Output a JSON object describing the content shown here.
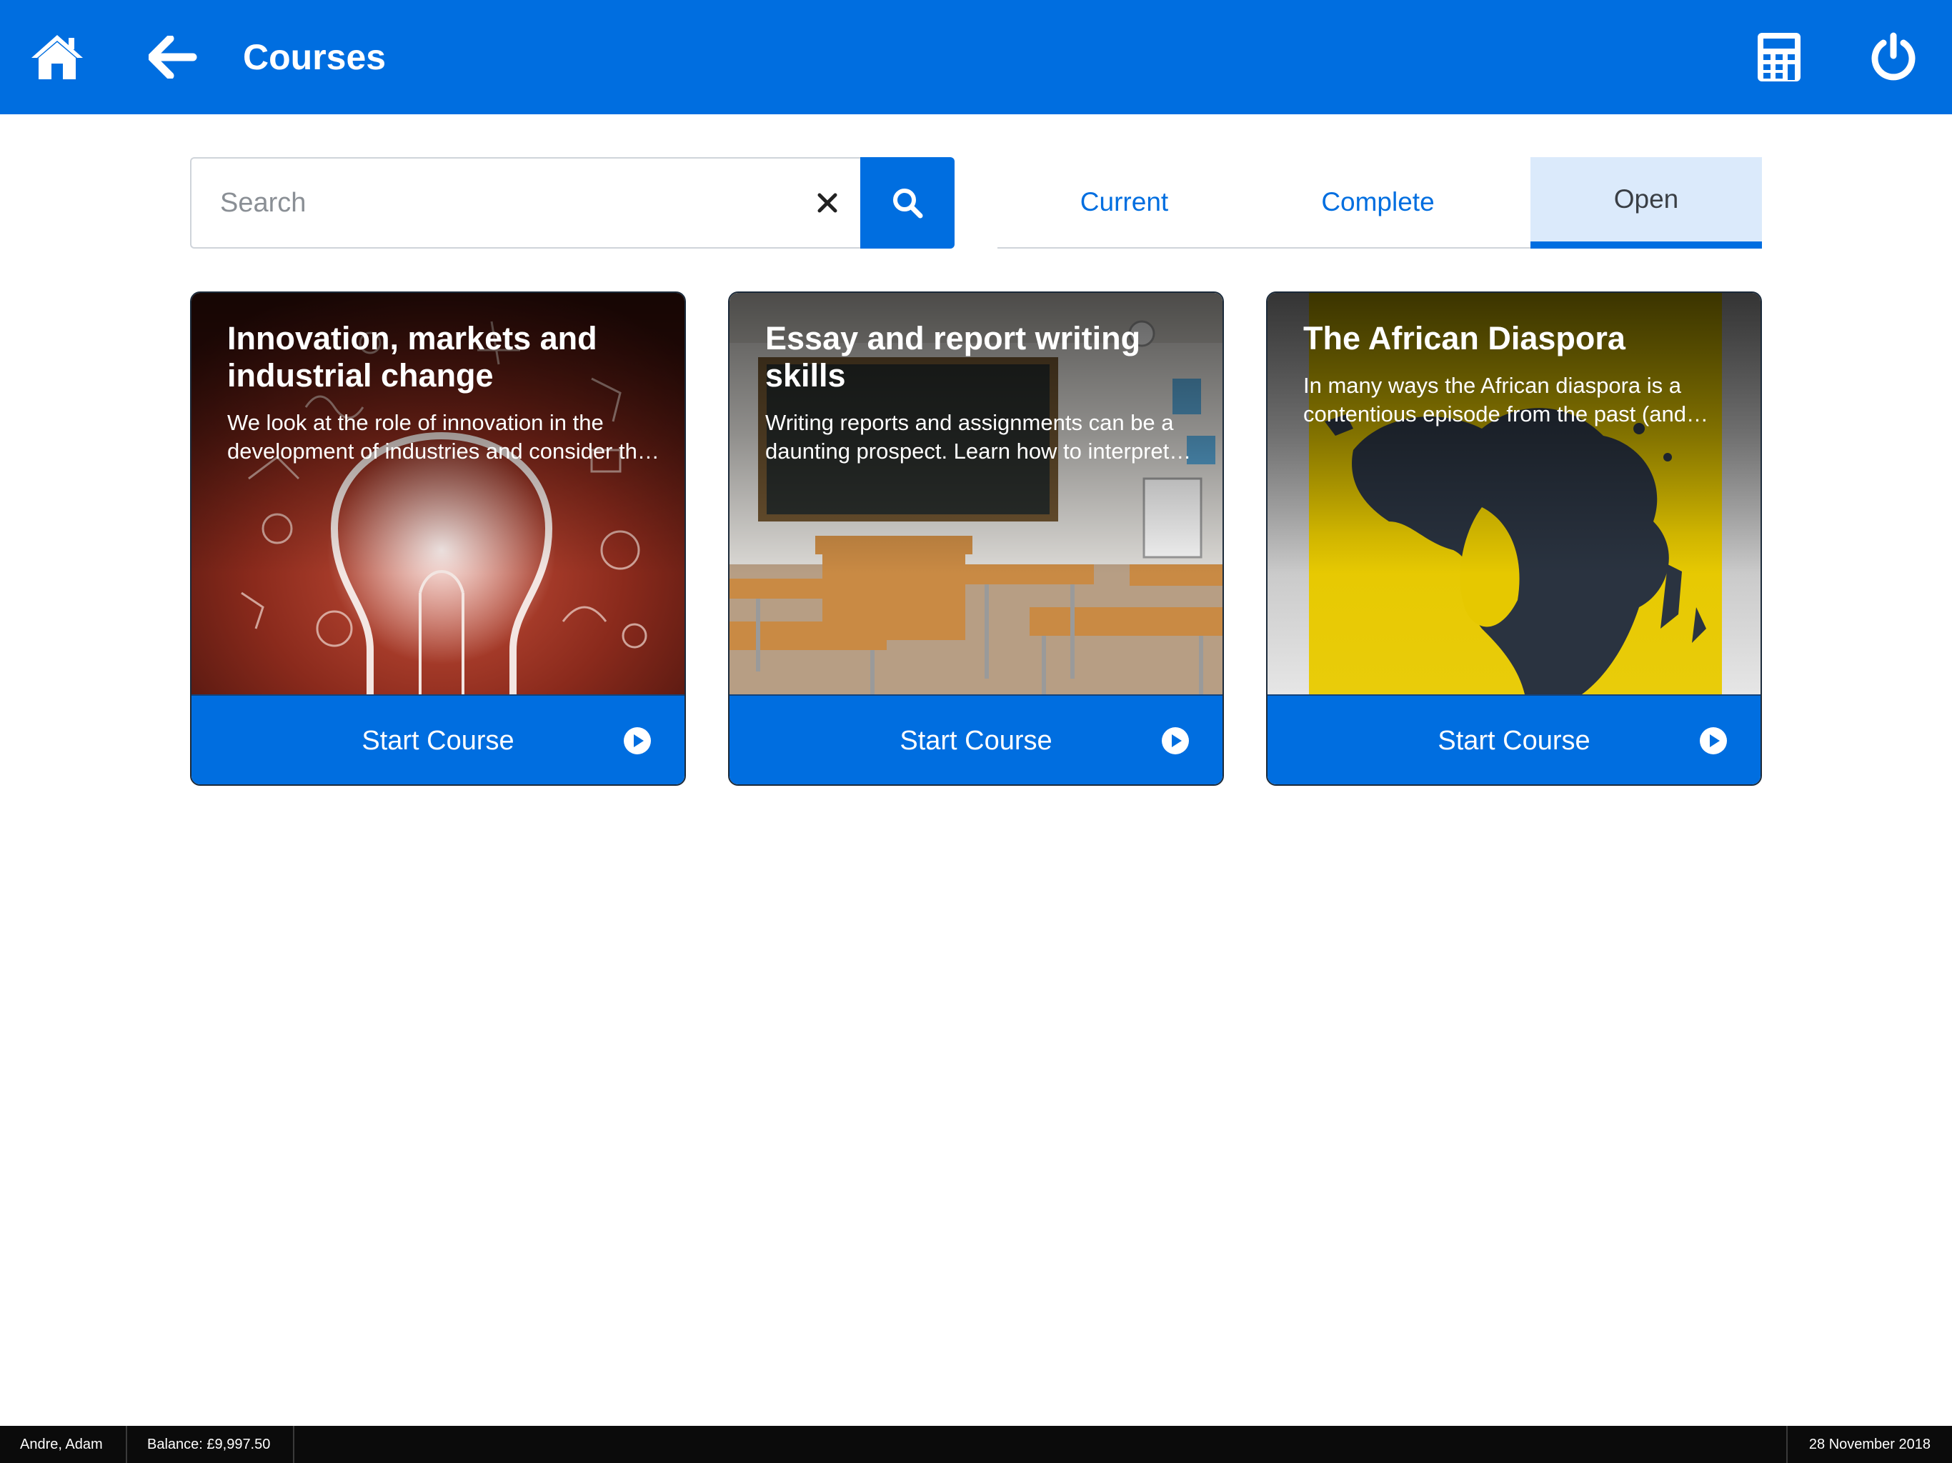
{
  "header": {
    "title": "Courses",
    "background_color": "#006ee0",
    "icons": {
      "home": "home-icon",
      "back": "arrow-left-icon",
      "calculator": "calculator-icon",
      "power": "power-icon"
    }
  },
  "search": {
    "placeholder": "Search",
    "value": "",
    "clear_icon": "close-icon",
    "submit_icon": "search-icon"
  },
  "tabs": [
    {
      "label": "Current",
      "selected": false
    },
    {
      "label": "Complete",
      "selected": false
    },
    {
      "label": "Open",
      "selected": true
    }
  ],
  "courses": [
    {
      "title": "Innovation, markets and industrial change",
      "description": "We look at the role of innovation in the development of industries and consider the impact on markets and society.",
      "action_label": "Start Course",
      "action_icon": "play-circle-icon",
      "image": "lightbulb-illustration"
    },
    {
      "title": "Essay and report writing skills",
      "description": "Writing reports and assignments can be a daunting prospect. Learn how to interpret the question and plan your work.",
      "action_label": "Start Course",
      "action_icon": "play-circle-icon",
      "image": "classroom-photo"
    },
    {
      "title": "The African Diaspora",
      "description": "In many ways the African diaspora is a contentious episode from the past (and present) of world history.",
      "action_label": "Start Course",
      "action_icon": "play-circle-icon",
      "image": "africa-map-on-yellow"
    }
  ],
  "status_bar": {
    "user": "Andre, Adam",
    "balance": "Balance: £9,997.50",
    "date": "28 November 2018"
  },
  "colors": {
    "accent": "#006ee0",
    "selected_tab_bg": "#dbeafb",
    "status_bar_bg": "#0b0b0b"
  }
}
